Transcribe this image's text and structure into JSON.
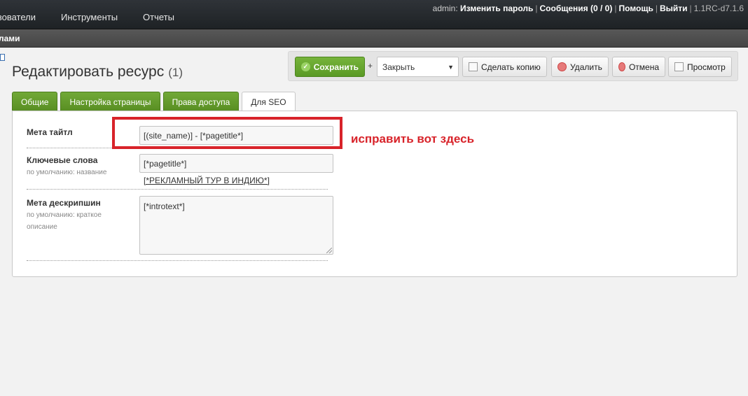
{
  "topnav": {
    "menu": [
      "ьзователи",
      "Инструменты",
      "Отчеты"
    ],
    "user_prefix": "admin:",
    "links": [
      "Изменить пароль",
      "Сообщения (0 / 0)",
      "Помощь",
      "Выйти"
    ],
    "version": "1.1RC-d7.1.6"
  },
  "subbar": {
    "label": "лами"
  },
  "page": {
    "title": "Редактировать ресурс",
    "count": "(1)"
  },
  "toolbar": {
    "save": "Сохранить",
    "plus": "+",
    "close_select": "Закрыть",
    "copy": "Сделать копию",
    "delete": "Удалить",
    "cancel": "Отмена",
    "preview": "Просмотр"
  },
  "tabs": [
    {
      "label": "Общие"
    },
    {
      "label": "Настройка страницы"
    },
    {
      "label": "Права доступа"
    },
    {
      "label": "Для SEO"
    }
  ],
  "fields": {
    "meta_title": {
      "label": "Мета тайтл",
      "value": "[(site_name)] - [*pagetitle*]"
    },
    "keywords": {
      "label": "Ключевые слова",
      "desc": "по умолчанию: название",
      "value": "[*pagetitle*]",
      "link": "[*РЕКЛАМНЫЙ ТУР В ИНДИЮ*]"
    },
    "meta_desc": {
      "label": "Мета дескрипшин",
      "desc": "по умолчанию: краткое описание",
      "value": "[*introtext*]"
    }
  },
  "annotation": {
    "note": "исправить вот здесь",
    "color": "#d8232a"
  }
}
